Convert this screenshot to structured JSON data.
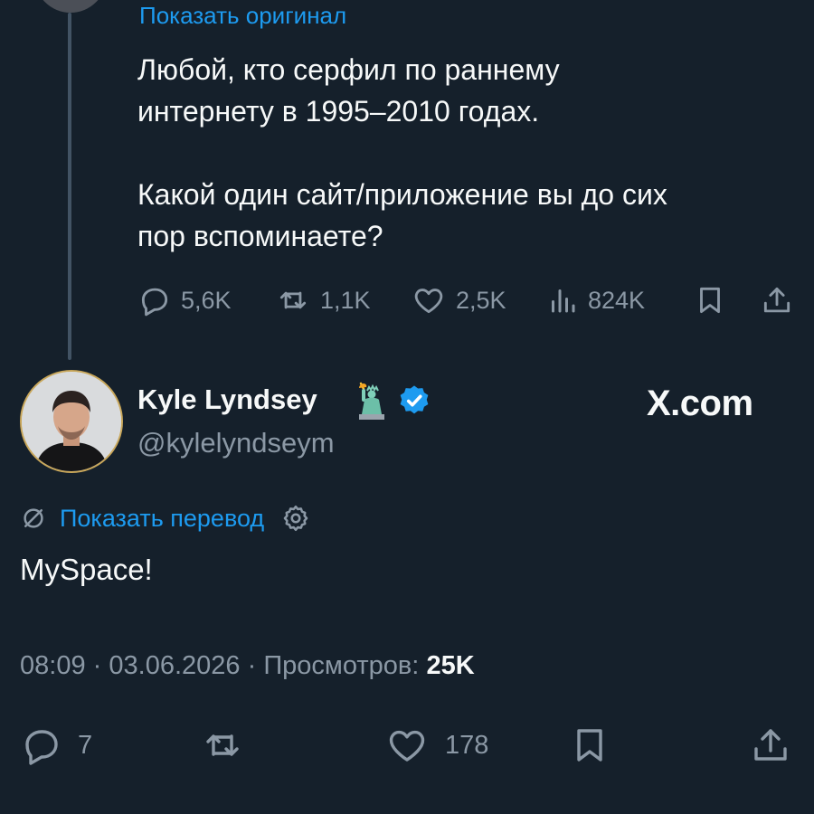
{
  "quoted_tweet": {
    "show_original_label": "Показать оригинал",
    "text": "Любой, кто серфил по раннему\nинтернету в 1995–2010 годах.\n\nКакой один сайт/приложение вы до сих\nпор вспоминаете?",
    "stats": {
      "replies": "5,6K",
      "reposts": "1,1K",
      "likes": "2,5K",
      "views": "824K"
    }
  },
  "reply_tweet": {
    "author": {
      "display_name": "Kyle Lyndsey",
      "handle": "@kylelyndseym",
      "verified": true
    },
    "brand": "X.com",
    "translate_label": "Показать перевод",
    "text": "MySpace!",
    "meta": {
      "time": "08:09",
      "separator": "·",
      "date": "03.06.2026",
      "views_label": "Просмотров:",
      "views_value": "25K"
    },
    "stats": {
      "replies": "7",
      "likes": "178"
    }
  },
  "colors": {
    "background": "#15202b",
    "text": "#f7f9f9",
    "muted": "#8b98a5",
    "accent": "#1d9bf0",
    "thread_line": "#425364"
  },
  "icons": [
    "reply-icon",
    "repost-icon",
    "like-icon",
    "views-icon",
    "bookmark-icon",
    "share-icon",
    "verified-icon",
    "translate-icon",
    "gear-icon",
    "statue-of-liberty-emoji"
  ]
}
